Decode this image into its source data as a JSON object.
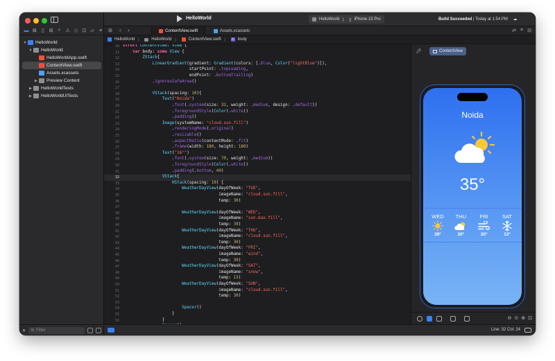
{
  "window": {
    "title": "HelloWorld"
  },
  "toolbar": {
    "project_title": "HelloWorld",
    "scheme": "HelloWorld",
    "device": "iPhone 15 Pro",
    "build_status": "Build Succeeded",
    "build_time": "| Today at 1:54 PM"
  },
  "tabs": [
    {
      "label": "ContentView.swift",
      "active": true
    },
    {
      "label": "Assets.xcassets",
      "active": false
    }
  ],
  "jumpbar": [
    "HelloWorld",
    "HelloWorld",
    "ContentView.swift",
    "body"
  ],
  "sidebar": {
    "items": [
      {
        "label": "HelloWorld",
        "level": 0,
        "icon": "project-icon",
        "expanded": true
      },
      {
        "label": "HelloWorld",
        "level": 1,
        "icon": "folder-icon",
        "expanded": true
      },
      {
        "label": "HelloWorldApp.swift",
        "level": 2,
        "icon": "swift-file-icon"
      },
      {
        "label": "ContentView.swift",
        "level": 2,
        "icon": "swift-file-icon",
        "selected": true
      },
      {
        "label": "Assets.xcassets",
        "level": 2,
        "icon": "asset-catalog-icon"
      },
      {
        "label": "Preview Content",
        "level": 2,
        "icon": "folder-icon",
        "expanded": false
      },
      {
        "label": "HelloWorldTests",
        "level": 1,
        "icon": "folder-icon",
        "expanded": false
      },
      {
        "label": "HelloWorldUITests",
        "level": 1,
        "icon": "folder-icon",
        "expanded": false
      }
    ],
    "filter_placeholder": "Filter"
  },
  "editor": {
    "current_line": 32,
    "lines": [
      {
        "n": "10",
        "t": "struct ContentView: View {"
      },
      {
        "n": "11",
        "t": "    var body: some View {"
      },
      {
        "n": "12",
        "t": "        ZStack{"
      },
      {
        "n": "13",
        "t": "            LinearGradient(gradient: Gradient(colors: [.blue, Color(\"lightBlue\")]),"
      },
      {
        "n": "14",
        "t": "                           startPoint: .topLeading,"
      },
      {
        "n": "15",
        "t": "                           endPoint: .bottomTrailing)"
      },
      {
        "n": "16",
        "t": "            .ignoresSafeArea()"
      },
      {
        "n": "17",
        "t": ""
      },
      {
        "n": "18",
        "t": "            VStack(spacing: 10){"
      },
      {
        "n": "19",
        "t": "                Text(\"Noida\")"
      },
      {
        "n": "20",
        "t": "                    .font(.system(size: 32, weight: .medium, design: .default))"
      },
      {
        "n": "21",
        "t": "                    .foregroundStyle(Color(.white))"
      },
      {
        "n": "22",
        "t": "                    .padding()"
      },
      {
        "n": "23",
        "t": "                Image(systemName: \"cloud.sun.fill\")"
      },
      {
        "n": "24",
        "t": "                    .renderingMode(.original)"
      },
      {
        "n": "25",
        "t": "                    .resizable()"
      },
      {
        "n": "26",
        "t": "                    .aspectRatio(contentMode: .fit)"
      },
      {
        "n": "27",
        "t": "                    .frame(width: 180, height: 180)"
      },
      {
        "n": "28",
        "t": "                Text(\"36°\")"
      },
      {
        "n": "29",
        "t": "                    .font(.system(size: 70, weight: .medium))"
      },
      {
        "n": "30",
        "t": "                    .foregroundStyle(Color(.white))"
      },
      {
        "n": "31",
        "t": "                    .padding(.bottom, 40)"
      },
      {
        "n": "32",
        "t": "                VStack{"
      },
      {
        "n": "33",
        "t": "                    HStack(spacing: 10) {"
      },
      {
        "n": "34",
        "t": "                        WeatherDayView(dayOfWeek: \"TUE\","
      },
      {
        "n": "35",
        "t": "                                       imageName: \"cloud.sun.fill\","
      },
      {
        "n": "36",
        "t": "                                       temp: 30)"
      },
      {
        "n": "37",
        "t": ""
      },
      {
        "n": "38",
        "t": "                        WeatherDayView(dayOfWeek: \"WED\","
      },
      {
        "n": "39",
        "t": "                                       imageName: \"sun.max.fill\","
      },
      {
        "n": "40",
        "t": "                                       temp: 39)"
      },
      {
        "n": "41",
        "t": "                        WeatherDayView(dayOfWeek: \"THU\","
      },
      {
        "n": "42",
        "t": "                                       imageName: \"cloud.sun.fill\","
      },
      {
        "n": "43",
        "t": "                                       temp: 30)"
      },
      {
        "n": "44",
        "t": "                        WeatherDayView(dayOfWeek: \"FRI\","
      },
      {
        "n": "45",
        "t": "                                       imageName: \"wind\","
      },
      {
        "n": "46",
        "t": "                                       temp: 30)"
      },
      {
        "n": "47",
        "t": "                        WeatherDayView(dayOfWeek: \"SAT\","
      },
      {
        "n": "48",
        "t": "                                       imageName: \"snow\","
      },
      {
        "n": "49",
        "t": "                                       temp: 13)"
      },
      {
        "n": "50",
        "t": "                        WeatherDayView(dayOfWeek: \"SUN\","
      },
      {
        "n": "51",
        "t": "                                       imageName: \"cloud.sun.fill\","
      },
      {
        "n": "52",
        "t": "                                       temp: 30)"
      },
      {
        "n": "53",
        "t": ""
      },
      {
        "n": "54",
        "t": "                        Spacer()"
      },
      {
        "n": "55",
        "t": "                    }"
      },
      {
        "n": "56",
        "t": "                }"
      },
      {
        "n": "57",
        "t": "                Spacer()"
      },
      {
        "n": "58",
        "t": "            }"
      }
    ]
  },
  "canvas": {
    "preview_label": "ContentView",
    "city": "Noida",
    "temperature": "35°",
    "days": [
      {
        "name": "WED",
        "icon": "sun-icon",
        "temp": "39°"
      },
      {
        "name": "THU",
        "icon": "cloud-sun-icon",
        "temp": "30°"
      },
      {
        "name": "FRI",
        "icon": "wind-icon",
        "temp": "30°"
      },
      {
        "name": "SAT",
        "icon": "snowflake-icon",
        "temp": "13°"
      }
    ]
  },
  "statusbar": {
    "cursor": "Line: 32  Col: 24"
  },
  "colors": {
    "accent": "#3b82f6",
    "editor_bg": "#1e1e20",
    "sidebar_bg": "#2a2a2c",
    "sky_top": "#2e6ff0",
    "sky_bottom": "#79b3f6"
  }
}
